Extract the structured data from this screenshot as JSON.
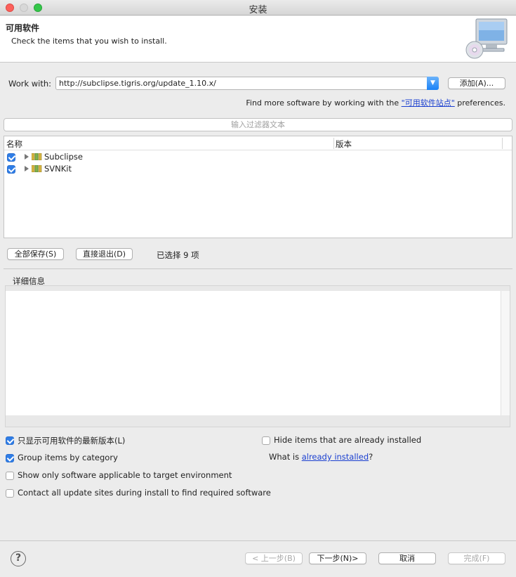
{
  "window": {
    "title": "安装"
  },
  "header": {
    "title": "可用软件",
    "description": "Check the items that you wish to install."
  },
  "work_with": {
    "label": "Work with:",
    "value": "http://subclipse.tigris.org/update_1.10.x/",
    "add_label": "添加(A)...",
    "find_more_prefix": "Find more software by working with the ",
    "find_more_link": "\"可用软件站点\"",
    "find_more_suffix": " preferences."
  },
  "filter": {
    "placeholder": "输入过滤器文本"
  },
  "table": {
    "columns": [
      "名称",
      "版本"
    ],
    "rows": [
      {
        "label": "Subclipse",
        "checked": true
      },
      {
        "label": "SVNKit",
        "checked": true
      }
    ]
  },
  "selection": {
    "select_all_label": "全部保存(S)",
    "deselect_all_label": "直接退出(D)",
    "count_text": "已选择 9 项"
  },
  "details": {
    "label": "详细信息"
  },
  "options": {
    "latest": {
      "label": "只显示可用软件的最新版本(L)",
      "checked": true
    },
    "hide_installed": {
      "label": "Hide items that are already installed",
      "checked": false
    },
    "group": {
      "label": "Group items by category",
      "checked": true
    },
    "applicable": {
      "label": "Show only software applicable to target environment",
      "checked": false
    },
    "contact": {
      "label": "Contact all update sites during install to find required software",
      "checked": false
    },
    "whatis_prefix": "What is ",
    "whatis_link": "already installed",
    "whatis_suffix": "?"
  },
  "footer": {
    "help": "?",
    "back": "< 上一步(B)",
    "next": "下一步(N)>",
    "cancel": "取消",
    "finish": "完成(F)"
  },
  "colors": {
    "accent": "#2f7de6",
    "link": "#1a3fd0"
  }
}
